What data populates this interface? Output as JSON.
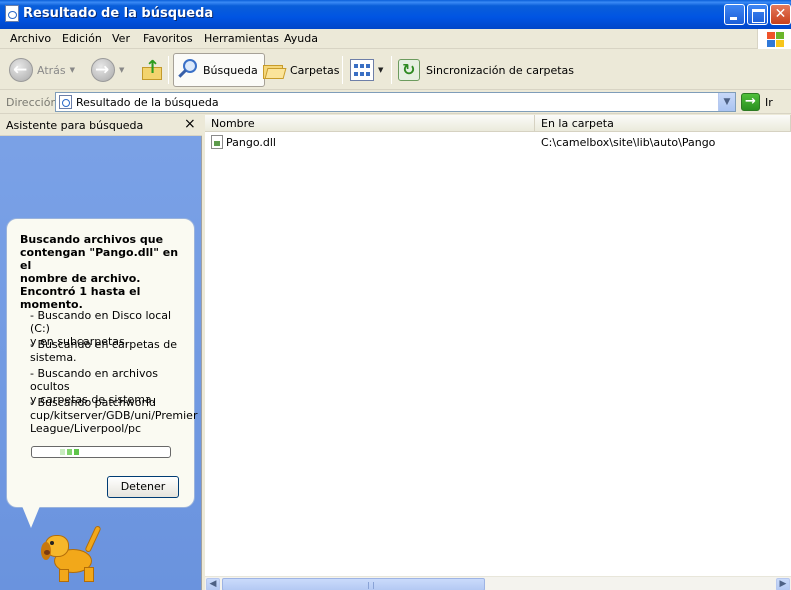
{
  "window": {
    "title": "Resultado de la búsqueda"
  },
  "menubar": {
    "items": [
      "Archivo",
      "Edición",
      "Ver",
      "Favoritos",
      "Herramientas",
      "Ayuda"
    ]
  },
  "toolbar": {
    "back_label": "Atrás",
    "search_label": "Búsqueda",
    "folders_label": "Carpetas",
    "sync_label": "Sincronización de carpetas"
  },
  "addressbar": {
    "label": "Dirección",
    "value": "Resultado de la búsqueda",
    "go_label": "Ir"
  },
  "search_pane": {
    "title": "Asistente para búsqueda",
    "close_glyph": "×",
    "heading": "Buscando archivos que\ncontengan \"Pango.dll\" en el\nnombre de archivo.\nEncontró 1 hasta el\nmomento.",
    "items": [
      "- Buscando en Disco local (C:)\ny en subcarpetas.",
      "- Buscando en carpetas de\nsistema.",
      "- Buscando en archivos ocultos\ny carpetas de sistema.",
      "- Buscando patchworld\ncup/kitserver/GDB/uni/Premier\nLeague/Liverpool/pc"
    ],
    "stop_label": "Detener"
  },
  "results": {
    "columns": [
      "Nombre",
      "En la carpeta"
    ],
    "rows": [
      {
        "name": "Pango.dll",
        "folder": "C:\\camelbox\\site\\lib\\auto\\Pango"
      }
    ]
  },
  "colors": {
    "titlebar": "#0054e3",
    "pane_blue": "#7ba2e7",
    "chrome": "#ece9d8"
  }
}
